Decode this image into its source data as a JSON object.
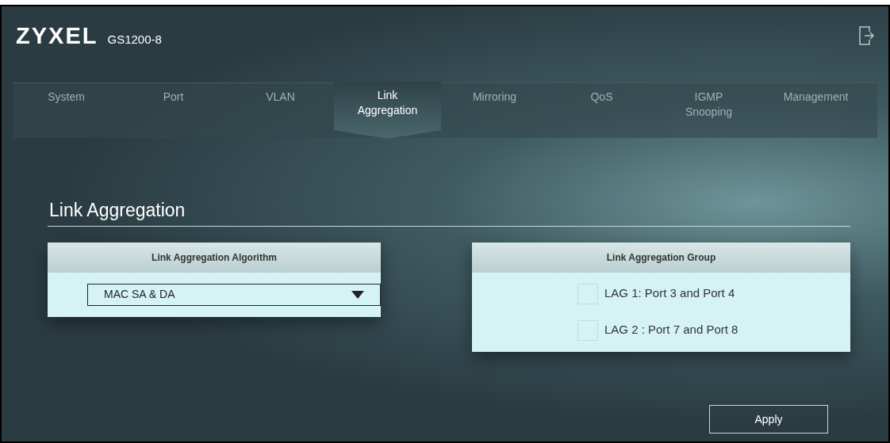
{
  "header": {
    "logo": "ZYXEL",
    "model": "GS1200-8"
  },
  "tabs": [
    {
      "label": "System",
      "selected": false
    },
    {
      "label": "Port",
      "selected": false
    },
    {
      "label": "VLAN",
      "selected": false
    },
    {
      "label": "Link\nAggregation",
      "selected": true
    },
    {
      "label": "Mirroring",
      "selected": false
    },
    {
      "label": "QoS",
      "selected": false
    },
    {
      "label": "IGMP\nSnooping",
      "selected": false
    },
    {
      "label": "Management",
      "selected": false
    }
  ],
  "section_title": "Link Aggregation",
  "algorithm_panel": {
    "title": "Link Aggregation Algorithm",
    "value": "MAC SA & DA"
  },
  "group_panel": {
    "title": "Link Aggregation Group",
    "groups": [
      {
        "label": "LAG 1: Port 3 and Port 4",
        "checked": false
      },
      {
        "label": "LAG 2 : Port 7 and Port 8",
        "checked": false
      }
    ]
  },
  "apply_button": "Apply"
}
